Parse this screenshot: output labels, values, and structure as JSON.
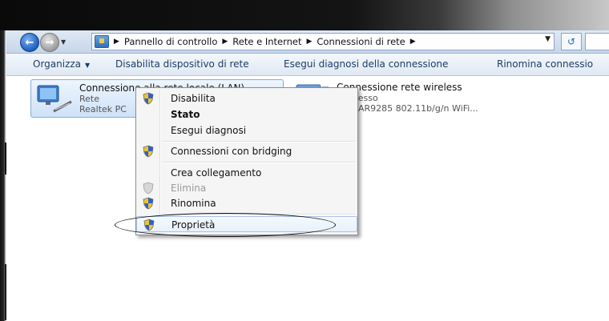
{
  "address": {
    "crumbs": [
      "Pannello di controllo",
      "Rete e Internet",
      "Connessioni di rete"
    ]
  },
  "toolbar": {
    "organize": "Organizza",
    "disable_device": "Disabilita dispositivo di rete",
    "diagnose": "Esegui diagnosi della connessione",
    "rename": "Rinomina connessio"
  },
  "connections": [
    {
      "title": "Connessione alla rete locale (LAN)",
      "status": "Rete",
      "device": "Realtek PC"
    },
    {
      "title": "Connessione rete wireless",
      "status": "connesso",
      "device": "eros AR9285 802.11b/g/n WiFi..."
    }
  ],
  "menu": {
    "items": [
      {
        "label": "Disabilita",
        "icon": "shield-icon"
      },
      {
        "label": "Stato"
      },
      {
        "label": "Esegui diagnosi"
      },
      {
        "label": "Connessioni con bridging",
        "icon": "shield-icon"
      },
      {
        "label": "Crea collegamento"
      },
      {
        "label": "Elimina",
        "icon": "shield-icon",
        "disabled": true
      },
      {
        "label": "Rinomina",
        "icon": "shield-icon"
      },
      {
        "label": "Proprietà",
        "icon": "shield-icon",
        "highlighted": true
      }
    ]
  },
  "colors": {
    "accent": "#1e3c62",
    "highlight_border": "#a9c5e8"
  }
}
